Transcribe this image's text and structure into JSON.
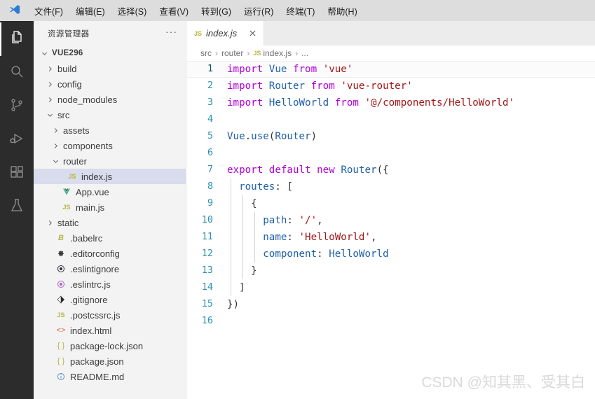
{
  "app": {
    "logo_icon": "vscode-logo",
    "menu": [
      {
        "label": "文件(F)",
        "mnemonic": "F"
      },
      {
        "label": "编辑(E)",
        "mnemonic": "E"
      },
      {
        "label": "选择(S)",
        "mnemonic": "S"
      },
      {
        "label": "查看(V)",
        "mnemonic": "V"
      },
      {
        "label": "转到(G)",
        "mnemonic": "G"
      },
      {
        "label": "运行(R)",
        "mnemonic": "R"
      },
      {
        "label": "终端(T)",
        "mnemonic": "T"
      },
      {
        "label": "帮助(H)",
        "mnemonic": "H"
      }
    ]
  },
  "activitybar": {
    "items": [
      {
        "name": "explorer",
        "icon": "files-icon",
        "active": true
      },
      {
        "name": "search",
        "icon": "search-icon",
        "active": false
      },
      {
        "name": "source-control",
        "icon": "source-control-icon",
        "active": false
      },
      {
        "name": "run-and-debug",
        "icon": "run-debug-icon",
        "active": false
      },
      {
        "name": "extensions",
        "icon": "extensions-icon",
        "active": false
      },
      {
        "name": "testing",
        "icon": "beaker-icon",
        "active": false
      }
    ]
  },
  "sidebar": {
    "title": "资源管理器",
    "more_actions": "···",
    "root": "VUE296",
    "tree": [
      {
        "label": "VUE296",
        "depth": 0,
        "type": "root",
        "state": "expanded",
        "icon": "",
        "selected": false
      },
      {
        "label": "build",
        "depth": 1,
        "type": "folder",
        "state": "collapsed",
        "icon": "",
        "selected": false
      },
      {
        "label": "config",
        "depth": 1,
        "type": "folder",
        "state": "collapsed",
        "icon": "",
        "selected": false
      },
      {
        "label": "node_modules",
        "depth": 1,
        "type": "folder",
        "state": "collapsed",
        "icon": "",
        "selected": false
      },
      {
        "label": "src",
        "depth": 1,
        "type": "folder",
        "state": "expanded",
        "icon": "",
        "selected": false
      },
      {
        "label": "assets",
        "depth": 2,
        "type": "folder",
        "state": "collapsed",
        "icon": "",
        "selected": false
      },
      {
        "label": "components",
        "depth": 2,
        "type": "folder",
        "state": "collapsed",
        "icon": "",
        "selected": false
      },
      {
        "label": "router",
        "depth": 2,
        "type": "folder",
        "state": "expanded",
        "icon": "",
        "selected": false
      },
      {
        "label": "index.js",
        "depth": 3,
        "type": "file",
        "state": "",
        "icon": "js-icon",
        "selected": true
      },
      {
        "label": "App.vue",
        "depth": 2,
        "type": "file",
        "state": "",
        "icon": "vue-icon",
        "selected": false
      },
      {
        "label": "main.js",
        "depth": 2,
        "type": "file",
        "state": "",
        "icon": "js-icon",
        "selected": false
      },
      {
        "label": "static",
        "depth": 1,
        "type": "folder",
        "state": "collapsed",
        "icon": "",
        "selected": false
      },
      {
        "label": ".babelrc",
        "depth": 1,
        "type": "file",
        "state": "",
        "icon": "babel-icon",
        "selected": false
      },
      {
        "label": ".editorconfig",
        "depth": 1,
        "type": "file",
        "state": "",
        "icon": "gear-icon",
        "selected": false
      },
      {
        "label": ".eslintignore",
        "depth": 1,
        "type": "file",
        "state": "",
        "icon": "eslint-dark-icon",
        "selected": false
      },
      {
        "label": ".eslintrc.js",
        "depth": 1,
        "type": "file",
        "state": "",
        "icon": "eslint-icon",
        "selected": false
      },
      {
        "label": ".gitignore",
        "depth": 1,
        "type": "file",
        "state": "",
        "icon": "git-icon",
        "selected": false
      },
      {
        "label": ".postcssrc.js",
        "depth": 1,
        "type": "file",
        "state": "",
        "icon": "js-icon",
        "selected": false
      },
      {
        "label": "index.html",
        "depth": 1,
        "type": "file",
        "state": "",
        "icon": "html-icon",
        "selected": false
      },
      {
        "label": "package-lock.json",
        "depth": 1,
        "type": "file",
        "state": "",
        "icon": "json-icon",
        "selected": false
      },
      {
        "label": "package.json",
        "depth": 1,
        "type": "file",
        "state": "",
        "icon": "json-icon",
        "selected": false
      },
      {
        "label": "README.md",
        "depth": 1,
        "type": "file",
        "state": "",
        "icon": "info-icon",
        "selected": false
      }
    ]
  },
  "editor": {
    "tab": {
      "label": "index.js",
      "icon": "js-icon",
      "close_icon": "close-icon",
      "preview": true
    },
    "breadcrumbs": [
      "src",
      "router",
      "index.js",
      "..."
    ],
    "breadcrumb_file_icon": "js-icon",
    "current_line": 1,
    "lines": [
      {
        "n": 1,
        "tokens": [
          {
            "t": "import ",
            "c": "kw"
          },
          {
            "t": "Vue ",
            "c": "id"
          },
          {
            "t": "from ",
            "c": "kw"
          },
          {
            "t": "'vue'",
            "c": "str"
          }
        ]
      },
      {
        "n": 2,
        "tokens": [
          {
            "t": "import ",
            "c": "kw"
          },
          {
            "t": "Router ",
            "c": "id"
          },
          {
            "t": "from ",
            "c": "kw"
          },
          {
            "t": "'vue-router'",
            "c": "str"
          }
        ]
      },
      {
        "n": 3,
        "tokens": [
          {
            "t": "import ",
            "c": "kw"
          },
          {
            "t": "HelloWorld ",
            "c": "id"
          },
          {
            "t": "from ",
            "c": "kw"
          },
          {
            "t": "'@/components/HelloWorld'",
            "c": "str"
          }
        ]
      },
      {
        "n": 4,
        "tokens": []
      },
      {
        "n": 5,
        "tokens": [
          {
            "t": "Vue",
            "c": "id"
          },
          {
            "t": ".",
            "c": "pl"
          },
          {
            "t": "use",
            "c": "id"
          },
          {
            "t": "(",
            "c": "pl"
          },
          {
            "t": "Router",
            "c": "id"
          },
          {
            "t": ")",
            "c": "pl"
          }
        ]
      },
      {
        "n": 6,
        "tokens": []
      },
      {
        "n": 7,
        "tokens": [
          {
            "t": "export ",
            "c": "kw"
          },
          {
            "t": "default ",
            "c": "kw"
          },
          {
            "t": "new ",
            "c": "kw"
          },
          {
            "t": "Router",
            "c": "id"
          },
          {
            "t": "({",
            "c": "pl"
          }
        ]
      },
      {
        "n": 8,
        "tokens": [
          {
            "t": "  ",
            "c": "pl"
          },
          {
            "t": "routes",
            "c": "id"
          },
          {
            "t": ": [",
            "c": "pl"
          }
        ],
        "guides": [
          1
        ]
      },
      {
        "n": 9,
        "tokens": [
          {
            "t": "    {",
            "c": "pl"
          }
        ],
        "guides": [
          1,
          2
        ]
      },
      {
        "n": 10,
        "tokens": [
          {
            "t": "      ",
            "c": "pl"
          },
          {
            "t": "path",
            "c": "id"
          },
          {
            "t": ": ",
            "c": "pl"
          },
          {
            "t": "'/'",
            "c": "str"
          },
          {
            "t": ",",
            "c": "pl"
          }
        ],
        "guides": [
          1,
          2,
          3
        ]
      },
      {
        "n": 11,
        "tokens": [
          {
            "t": "      ",
            "c": "pl"
          },
          {
            "t": "name",
            "c": "id"
          },
          {
            "t": ": ",
            "c": "pl"
          },
          {
            "t": "'HelloWorld'",
            "c": "str"
          },
          {
            "t": ",",
            "c": "pl"
          }
        ],
        "guides": [
          1,
          2,
          3
        ]
      },
      {
        "n": 12,
        "tokens": [
          {
            "t": "      ",
            "c": "pl"
          },
          {
            "t": "component",
            "c": "id"
          },
          {
            "t": ": ",
            "c": "pl"
          },
          {
            "t": "HelloWorld",
            "c": "id"
          }
        ],
        "guides": [
          1,
          2,
          3
        ]
      },
      {
        "n": 13,
        "tokens": [
          {
            "t": "    }",
            "c": "pl"
          }
        ],
        "guides": [
          1,
          2
        ]
      },
      {
        "n": 14,
        "tokens": [
          {
            "t": "  ]",
            "c": "pl"
          }
        ],
        "guides": [
          1
        ]
      },
      {
        "n": 15,
        "tokens": [
          {
            "t": "})",
            "c": "pl"
          }
        ]
      },
      {
        "n": 16,
        "tokens": []
      }
    ]
  },
  "watermark": "CSDN @知其黑、受其白",
  "colors": {
    "menubar_bg": "#dddddd",
    "activitybar_bg": "#2c2c2c",
    "sidebar_bg": "#f3f3f3",
    "selection_bg": "#d8dcec",
    "tabbar_bg": "#ececec",
    "keyword": "#af00db",
    "identifier": "#1f5fa9",
    "string": "#a31515",
    "linenumber": "#2b91af",
    "js_icon": "#b7b73b",
    "vue_icon": "#41b883",
    "watermark": "#d9d9d9"
  }
}
